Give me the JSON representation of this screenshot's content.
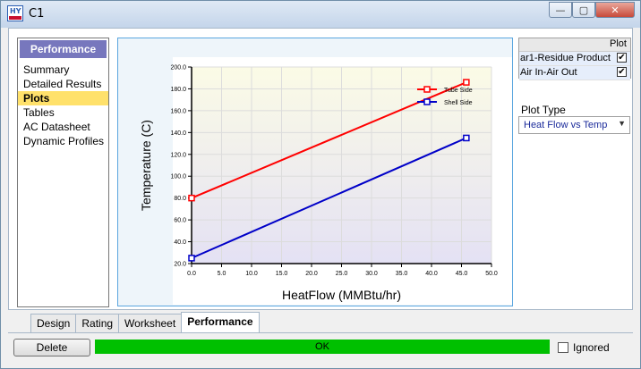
{
  "window": {
    "title": "C1",
    "min_symbol": "—",
    "max_symbol": "▢",
    "close_symbol": "✕",
    "icon": "hysys-app-icon"
  },
  "nav": {
    "header": "Performance",
    "items": [
      {
        "label": "Summary",
        "active": false
      },
      {
        "label": "Detailed Results",
        "active": false
      },
      {
        "label": "Plots",
        "active": true
      },
      {
        "label": "Tables",
        "active": false
      },
      {
        "label": "AC Datasheet",
        "active": false
      },
      {
        "label": "Dynamic Profiles",
        "active": false
      }
    ]
  },
  "selection": {
    "column_header": "Plot",
    "rows": [
      {
        "label": "ar1-Residue Product",
        "checked": true
      },
      {
        "label": "Air In-Air Out",
        "checked": true
      }
    ]
  },
  "plot_type": {
    "label": "Plot Type",
    "value": "Heat Flow vs Temp"
  },
  "chart_data": {
    "type": "line",
    "xlabel": "HeatFlow (MMBtu/hr)",
    "ylabel": "Temperature (C)",
    "xlim": [
      0,
      50
    ],
    "ylim": [
      20,
      200
    ],
    "x_ticks": [
      "0.0",
      "5.0",
      "10.0",
      "15.0",
      "20.0",
      "25.0",
      "30.0",
      "35.0",
      "40.0",
      "45.0",
      "50.0"
    ],
    "y_ticks": [
      "20.0",
      "40.0",
      "60.0",
      "80.0",
      "100.0",
      "120.0",
      "140.0",
      "160.0",
      "180.0",
      "200.0"
    ],
    "legend_position": "top-right",
    "series": [
      {
        "name": "Tube Side",
        "color": "#ff0000",
        "points": [
          [
            0,
            80
          ],
          [
            45.8,
            186
          ]
        ]
      },
      {
        "name": "Shell Side",
        "color": "#0000c8",
        "points": [
          [
            0,
            25
          ],
          [
            45.8,
            135
          ]
        ]
      }
    ]
  },
  "tabs": [
    {
      "label": "Design",
      "active": false
    },
    {
      "label": "Rating",
      "active": false
    },
    {
      "label": "Worksheet",
      "active": false
    },
    {
      "label": "Performance",
      "active": true
    }
  ],
  "footer": {
    "delete_label": "Delete",
    "status_text": "OK",
    "status_color": "#00c000",
    "ignored_label": "Ignored"
  }
}
